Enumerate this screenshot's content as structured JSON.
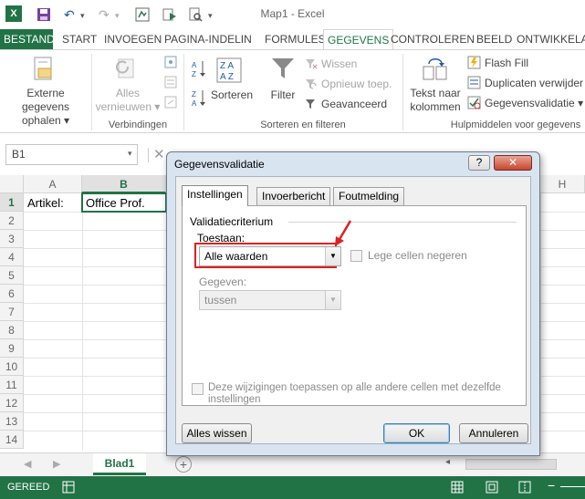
{
  "app": {
    "title": "Map1 - Excel"
  },
  "tabs": [
    "BESTAND",
    "START",
    "INVOEGEN",
    "PAGINA-INDELIN",
    "FORMULES",
    "GEGEVENS",
    "CONTROLEREN",
    "BEELD",
    "ONTWIKKELAA"
  ],
  "ribbon": {
    "external_data": [
      "Externe gegevens",
      "ophalen"
    ],
    "refresh_all": [
      "Alles",
      "vernieuwen"
    ],
    "connections_group": "Verbindingen",
    "sort_group": "Sorteren en filteren",
    "sort_label": "Sorteren",
    "filter_label": "Filter",
    "clear_label": "Wissen",
    "reapply_label": "Opnieuw toep.",
    "advanced_label": "Geavanceerd",
    "text_to_columns": [
      "Tekst naar",
      "kolommen"
    ],
    "flash_fill": "Flash Fill",
    "remove_duplicates": "Duplicaten verwijder",
    "data_validation": "Gegevensvalidatie",
    "tools_group": "Hulpmiddelen voor gegevens"
  },
  "formula_bar": {
    "name_box": "B1"
  },
  "grid": {
    "columns": [
      "A",
      "B"
    ],
    "col_h": "H",
    "rows": [
      "1",
      "2",
      "3",
      "4",
      "5",
      "6",
      "7",
      "8",
      "9",
      "10",
      "11",
      "12",
      "13",
      "14"
    ],
    "a1": "Artikel:",
    "b1": "Office Prof."
  },
  "sheet": {
    "tab": "Blad1"
  },
  "status": {
    "text": "GEREED"
  },
  "dialog": {
    "title": "Gegevensvalidatie",
    "help": "?",
    "tabs": [
      "Instellingen",
      "Invoerbericht",
      "Foutmelding"
    ],
    "section": "Validatiecriterium",
    "allow_label": "Toestaan:",
    "allow_value": "Alle waarden",
    "ignore_blank": "Lege cellen negeren",
    "data_label": "Gegeven:",
    "data_value": "tussen",
    "apply_all": [
      "Deze wijzigingen toepassen op alle andere cellen met dezelfde",
      "instellingen"
    ],
    "clear_all": "Alles wissen",
    "ok": "OK",
    "cancel": "Annuleren"
  },
  "colors": {
    "accent": "#217346",
    "highlight": "#e02020"
  }
}
